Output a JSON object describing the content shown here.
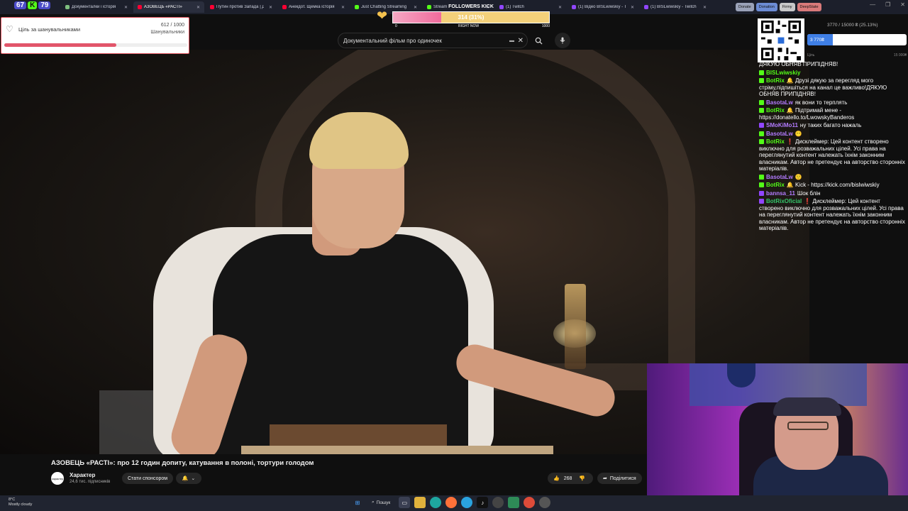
{
  "stream": {
    "counter_left": "67",
    "counter_mid": "K",
    "counter_right": "79"
  },
  "browser": {
    "tabs": [
      {
        "label": "Документалки і історія",
        "color": "#7fbf7f",
        "active": false
      },
      {
        "label": "АЗОВЕЦЬ «РАСТІ»",
        "color": "#ff0033",
        "active": true
      },
      {
        "label": "Путин против Запада | Д",
        "color": "#ff0033",
        "active": false
      },
      {
        "label": "Анекдот. Щемка історія",
        "color": "#ff0033",
        "active": false
      },
      {
        "label": "Just Chatting Streaming",
        "color": "#53fc18",
        "active": false
      },
      {
        "label": "Stream",
        "color": "#53fc18",
        "active": false
      },
      {
        "label": "(1) Twitch",
        "color": "#9146ff",
        "active": false
      },
      {
        "label": "(1) Відео BISLwiwskiy - T",
        "color": "#9146ff",
        "active": false
      },
      {
        "label": "(1) BISLwiwskiy - Twitch",
        "color": "#9146ff",
        "active": false
      }
    ],
    "pills": [
      {
        "label": "Donate",
        "color": "#9aa2b8"
      },
      {
        "label": "Donation",
        "color": "#6c8cd5"
      },
      {
        "label": "Firmy",
        "color": "#c8c8c8"
      },
      {
        "label": "DeepState",
        "color": "#d97a7a"
      }
    ],
    "window_controls": [
      "—",
      "❐",
      "✕"
    ]
  },
  "follower_goal": {
    "title": "Ціль за шанувальниками",
    "current": "612",
    "target": "1000",
    "unit": "Шанувальники",
    "progress": 0.612
  },
  "kick_followers": {
    "label": "FOLLOWERS KICK",
    "value": "314 (31%)",
    "progress": 0.31,
    "min": "0",
    "mid": "RIGHT NOW",
    "max": "1000"
  },
  "youtube": {
    "search_value": "Документальний фільм  про одиночек",
    "video_title": "АЗОВЕЦЬ «РАСТІ»: про 12 годин допиту, катування в полоні, тортури голодом",
    "channel_name": "Характер",
    "channel_subs": "24,6 тис. підписників",
    "avatar_text": "характер",
    "sponsor_label": "Стати спонсором",
    "likes": "268",
    "share_label": "Поділитися"
  },
  "donation_goal": {
    "line": "3770 / 15000 ₴ (25.13%)",
    "fill_label": "3 770₴",
    "progress": 0.2513,
    "min_label": "Ціль",
    "max_label": "15 000₴"
  },
  "chat": [
    {
      "user": "",
      "text": "ДЯКУЮ ОБНЯВ ПРИПІДНЯВ!",
      "color": "#fff",
      "badge": ""
    },
    {
      "user": "BISLwiwskiy",
      "text": "",
      "color": "#53fc18",
      "badge": "kick"
    },
    {
      "user": "BotRix",
      "text": "🔔 Друзі дякую за перегляд мого стріму,підпишіться на канал це важливо!ДЯКУЮ ОБНЯВ ПРИПІДНЯВ!",
      "color": "#53fc18",
      "badge": "kick"
    },
    {
      "user": "BasotaLw",
      "text": "як вони то терплять",
      "color": "#b37bff",
      "badge": "kick"
    },
    {
      "user": "BotRix",
      "text": "🔔 Підтримай мене - https://donatello.to/LwowskyBanderos",
      "color": "#53fc18",
      "badge": "kick"
    },
    {
      "user": "SMoKiMo11",
      "text": "ну таких багато нажаль",
      "color": "#b37bff",
      "badge": "tw"
    },
    {
      "user": "BasotaLw",
      "text": "😶",
      "color": "#b37bff",
      "badge": "kick"
    },
    {
      "user": "BotRix",
      "text": "❗ Дисклеймер: Цей контент створено виключно для розважальних цілей. Усі права на переглянутий контент належать їхнім законним власникам. Автор не претендує на авторство сторонніх матеріалів.",
      "color": "#53fc18",
      "badge": "kick"
    },
    {
      "user": "BasotaLw",
      "text": "🙂",
      "color": "#b37bff",
      "badge": "kick"
    },
    {
      "user": "BotRix",
      "text": "🔔 Kick - https://kick.com/bislwiwskiy",
      "color": "#53fc18",
      "badge": "kick"
    },
    {
      "user": "bannsa_11",
      "text": "Шок блін",
      "color": "#b37bff",
      "badge": "tw"
    },
    {
      "user": "BotRixOficial",
      "text": "❗ Дисклеймер: Цей контент створено виключно для розважальних цілей. Усі права на переглянутий контент належать їхнім законним власникам. Автор не претендує на авторство сторонніх матеріалів.",
      "color": "#36c76b",
      "badge": "tw"
    }
  ],
  "taskbar": {
    "weather_temp": "8°C",
    "weather_desc": "Mostly cloudy",
    "search_label": "Пошук"
  },
  "colors": {
    "yt_bg": "#0f0f0f",
    "kick_green": "#53fc18",
    "twitch_purple": "#9146ff",
    "goal_red": "#e2556a",
    "dono_blue": "#3f7fe6"
  }
}
